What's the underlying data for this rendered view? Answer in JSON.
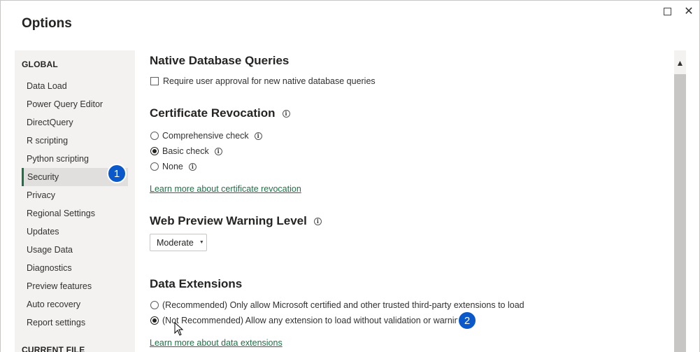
{
  "window": {
    "title": "Options",
    "maximize_icon": "maximize-icon",
    "close_icon": "close-icon",
    "close_glyph": "✕"
  },
  "sidebar": {
    "global_heading": "GLOBAL",
    "items": [
      {
        "label": "Data Load"
      },
      {
        "label": "Power Query Editor"
      },
      {
        "label": "DirectQuery"
      },
      {
        "label": "R scripting"
      },
      {
        "label": "Python scripting"
      },
      {
        "label": "Security",
        "active": true
      },
      {
        "label": "Privacy"
      },
      {
        "label": "Regional Settings"
      },
      {
        "label": "Updates"
      },
      {
        "label": "Usage Data"
      },
      {
        "label": "Diagnostics"
      },
      {
        "label": "Preview features"
      },
      {
        "label": "Auto recovery"
      },
      {
        "label": "Report settings"
      }
    ],
    "current_file_heading": "CURRENT FILE"
  },
  "callouts": {
    "one": "1",
    "two": "2",
    "color": "#0a58c9"
  },
  "main": {
    "native_queries": {
      "title": "Native Database Queries",
      "checkbox_label": "Require user approval for new native database queries",
      "checked": false
    },
    "cert_revocation": {
      "title": "Certificate Revocation",
      "options": [
        {
          "label": "Comprehensive check",
          "checked": false
        },
        {
          "label": "Basic check",
          "checked": true
        },
        {
          "label": "None",
          "checked": false
        }
      ],
      "learn_more": "Learn more about certificate revocation"
    },
    "web_preview": {
      "title": "Web Preview Warning Level",
      "selected": "Moderate"
    },
    "data_extensions": {
      "title": "Data Extensions",
      "options": [
        {
          "label": "(Recommended) Only allow Microsoft certified and other trusted third-party extensions to load",
          "checked": false
        },
        {
          "label": "(Not Recommended) Allow any extension to load without validation or warning",
          "checked": true
        }
      ],
      "learn_more": "Learn more about data extensions"
    }
  },
  "icons": {
    "info": "i",
    "caret": "▼",
    "scroll_up": "▲"
  },
  "colors": {
    "accent_green": "#1e7145",
    "sidebar_bg": "#f3f2f1",
    "callout_blue": "#0a58c9"
  }
}
